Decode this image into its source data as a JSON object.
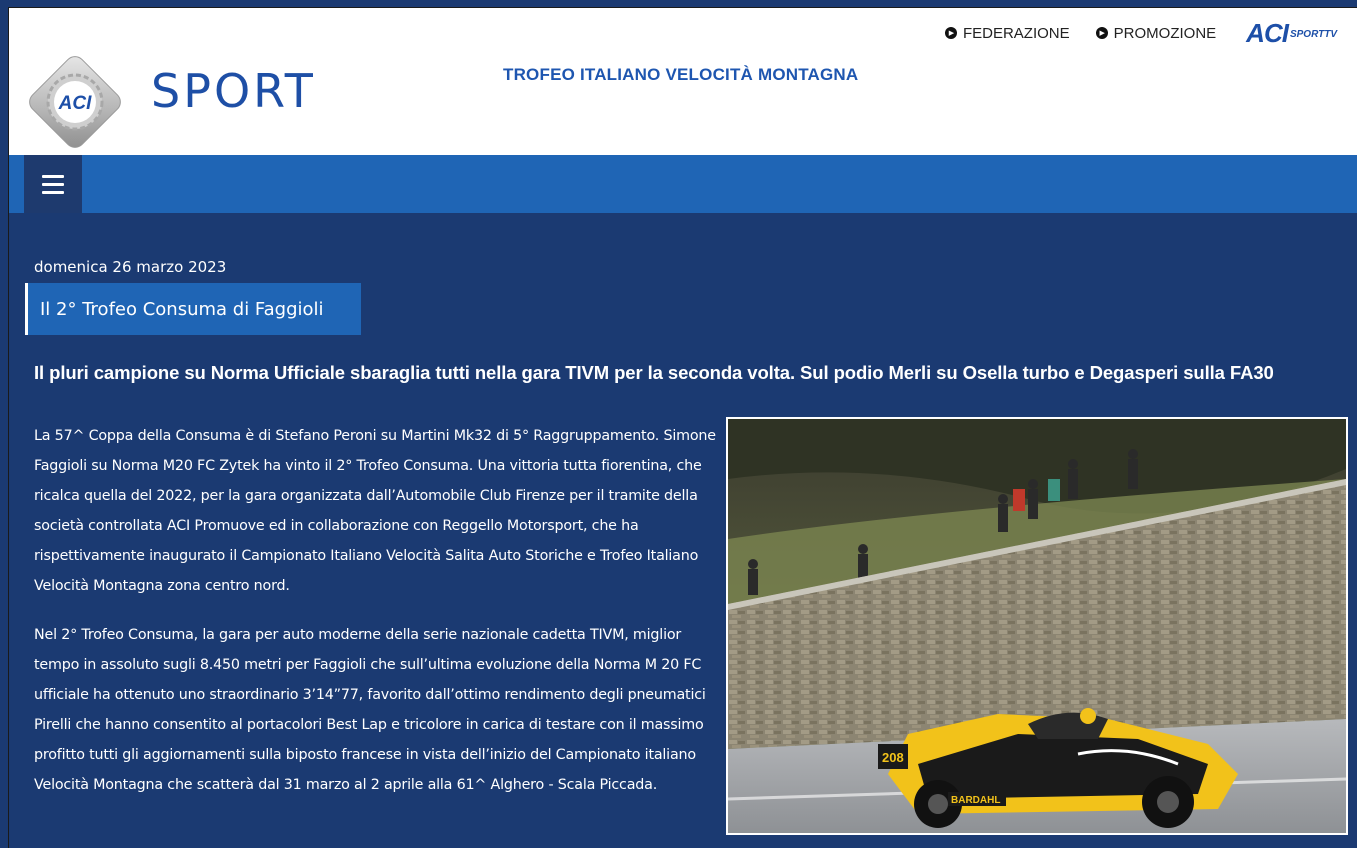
{
  "topnav": {
    "links": [
      {
        "label": "FEDERAZIONE"
      },
      {
        "label": "PROMOZIONE"
      }
    ],
    "sporttv_logo": {
      "aci": "ACI",
      "text": "SPORTTV"
    }
  },
  "logo": {
    "word": "SPORT",
    "badge": "ACI"
  },
  "site_title": "TROFEO ITALIANO VELOCITÀ MONTAGNA",
  "menu": {
    "icon": "hamburger-icon"
  },
  "article": {
    "date": "domenica 26 marzo 2023",
    "category": "Il 2° Trofeo Consuma di Faggioli",
    "headline": "Il pluri campione su Norma Ufficiale sbaraglia tutti nella gara TIVM per la seconda volta. Sul podio Merli su Osella turbo e Degasperi sulla FA30",
    "paragraphs": [
      "La 57^ Coppa della Consuma è di Stefano Peroni su Martini Mk32 di 5° Raggruppamento. Simone Faggioli su Norma M20 FC Zytek ha vinto il 2° Trofeo Consuma. Una vittoria tutta fiorentina, che ricalca quella del 2022, per la gara organizzata dall’Automobile Club Firenze per il tramite della società controllata ACI Promuove ed in collaborazione con Reggello Motorsport, che ha rispettivamente inaugurato il Campionato Italiano Velocità Salita Auto Storiche e Trofeo Italiano Velocità Montagna zona centro nord.",
      "Nel 2° Trofeo Consuma, la gara per auto moderne della serie nazionale cadetta TIVM, miglior tempo in assoluto sugli 8.450 metri per Faggioli che sull’ultima evoluzione della Norma M 20 FC ufficiale ha ottenuto uno straordinario 3’14”77, favorito dall’ottimo rendimento degli pneumatici Pirelli che hanno consentito al portacolori Best Lap e tricolore in carica di testare con il massimo profitto tutti gli aggiornamenti sulla biposto francese in vista dell’inizio del Campionato italiano Velocità Montagna che scatterà dal 31 marzo al 2 aprile alla 61^ Alghero - Scala Piccada."
    ],
    "photo": {
      "car_number": "208",
      "sponsor": "BARDAHL"
    }
  },
  "colors": {
    "page_bg": "#1b3a72",
    "menubar": "#1f65b5",
    "menu_button": "#1e3a6e",
    "title_blue": "#1e56b0"
  }
}
